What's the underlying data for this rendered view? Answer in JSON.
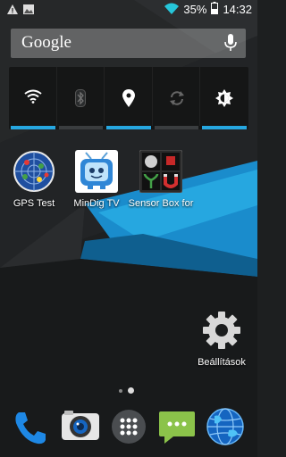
{
  "status_bar": {
    "battery_percent": "35%",
    "time": "14:32",
    "icons": [
      "warning-icon",
      "image-icon",
      "wifi-icon",
      "battery-icon"
    ]
  },
  "search": {
    "logo_text": "Google",
    "icon": "mic-icon"
  },
  "quick_settings": {
    "toggles": [
      {
        "name": "wifi-toggle",
        "icon": "wifi-icon",
        "enabled": true
      },
      {
        "name": "bluetooth-toggle",
        "icon": "bluetooth-icon",
        "enabled": false
      },
      {
        "name": "location-toggle",
        "icon": "location-icon",
        "enabled": true
      },
      {
        "name": "sync-toggle",
        "icon": "sync-icon",
        "enabled": false
      },
      {
        "name": "brightness-toggle",
        "icon": "brightness-icon",
        "enabled": true
      }
    ],
    "active_color": "#26a7e0"
  },
  "apps": [
    {
      "label": "GPS Test",
      "icon": "gps-radar-icon"
    },
    {
      "label": "MinDig TV",
      "icon": "tv-icon"
    },
    {
      "label": "Sensor Box for",
      "icon": "sensor-box-icon"
    },
    {
      "label": "Beállítások",
      "icon": "settings-gear-icon"
    }
  ],
  "page_indicator": {
    "pages": 2,
    "current": 2
  },
  "dock": [
    {
      "name": "phone",
      "icon": "phone-icon"
    },
    {
      "name": "camera",
      "icon": "camera-icon"
    },
    {
      "name": "app-drawer",
      "icon": "app-drawer-icon"
    },
    {
      "name": "messaging",
      "icon": "message-icon"
    },
    {
      "name": "browser",
      "icon": "globe-icon"
    }
  ],
  "colors": {
    "accent": "#26a7e0",
    "wallpaper_dark": "#1d1f20"
  }
}
